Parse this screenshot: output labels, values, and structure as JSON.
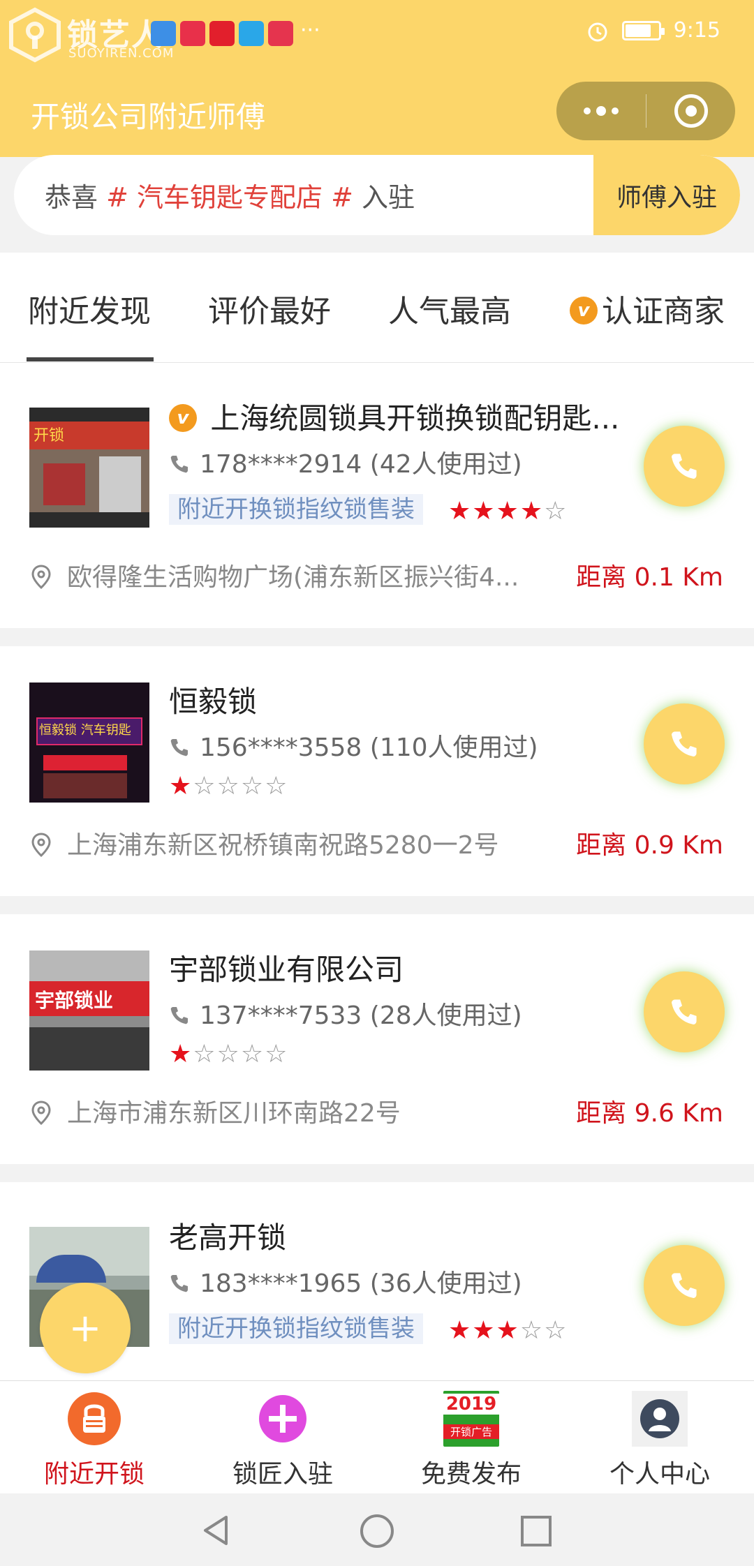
{
  "status_bar": {
    "watermark_text": "锁艺人",
    "watermark_sub": "SUOYIREN.COM",
    "time": "9:15",
    "more_dots": "···"
  },
  "header": {
    "title": "开锁公司附近师傅"
  },
  "notice": {
    "prefix": "恭喜",
    "hash1": " # ",
    "highlight": "汽车钥匙专配店",
    "hash2": " # ",
    "suffix": "入驻",
    "join_label": "师傅入驻"
  },
  "tabs": [
    {
      "label": "附近发现"
    },
    {
      "label": "评价最好"
    },
    {
      "label": "人气最高"
    },
    {
      "label": "认证商家",
      "badge": "v"
    }
  ],
  "listings": [
    {
      "name": "上海统圆锁具开锁换锁配钥匙...",
      "verified": true,
      "verified_badge": "v",
      "phone": "178****2914 (42人使用过)",
      "tag": "附近开换锁指纹锁售装",
      "rating": 4,
      "address": "欧得隆生活购物广场(浦东新区振兴街4...",
      "distance": "距离 0.1 Km",
      "thumb_text": "开锁"
    },
    {
      "name": "恒毅锁",
      "verified": false,
      "phone": "156****3558 (110人使用过)",
      "tag": "",
      "rating": 1,
      "address": "上海浦东新区祝桥镇南祝路5280一2号",
      "distance": "距离 0.9 Km",
      "thumb_text": "恒毅锁 汽车钥匙"
    },
    {
      "name": "宇部锁业有限公司",
      "verified": false,
      "phone": "137****7533 (28人使用过)",
      "tag": "",
      "rating": 1,
      "address": "上海市浦东新区川环南路22号",
      "distance": "距离 9.6 Km",
      "thumb_text": "宇部锁业"
    },
    {
      "name": "老高开锁",
      "verified": false,
      "phone": "183****1965 (36人使用过)",
      "tag": "附近开换锁指纹锁售装",
      "rating": 3,
      "address": "",
      "distance": "",
      "thumb_text": ""
    }
  ],
  "fab": {
    "label": "+"
  },
  "bottom_nav": [
    {
      "label": "附近开锁",
      "active": true
    },
    {
      "label": "锁匠入驻",
      "active": false
    },
    {
      "label": "免费发布",
      "active": false,
      "icon_text_top": "2019",
      "icon_text_bottom": "开锁广告"
    },
    {
      "label": "个人中心",
      "active": false
    }
  ],
  "colors": {
    "brand_yellow": "#fcd66a",
    "distance_red": "#d0141c",
    "star_red": "#e5121c",
    "verified_orange": "#f39a1e"
  }
}
